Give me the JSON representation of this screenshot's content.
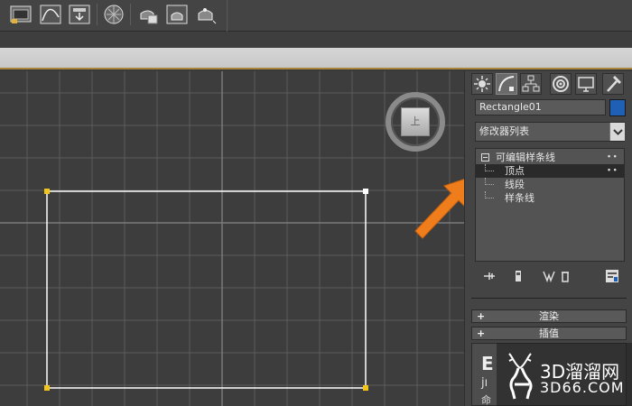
{
  "toolbar": {
    "icons": [
      "layer-manager-icon",
      "curve-editor-icon",
      "schematic-view-icon",
      "material-editor-icon",
      "render-setup-icon",
      "rendered-frame-icon",
      "render-icon"
    ]
  },
  "viewport": {
    "viewcube_label": "上"
  },
  "panel": {
    "tabs": [
      "create-tab",
      "modify-tab",
      "hierarchy-tab",
      "motion-tab",
      "display-tab",
      "utilities-tab"
    ],
    "active_tab": "modify-tab",
    "object_name": "Rectangle01",
    "object_color": "#1f5fb4",
    "modifier_list": "修改器列表",
    "stack": {
      "root": "可编辑样条线",
      "items": [
        {
          "label": "顶点",
          "selected": true
        },
        {
          "label": "线段",
          "selected": false
        },
        {
          "label": "样条线",
          "selected": false
        }
      ]
    },
    "rollouts": [
      {
        "sign": "+",
        "label": "渲染"
      },
      {
        "sign": "+",
        "label": "插值"
      }
    ],
    "partial_text": {
      "big": "E",
      "small": "jı",
      "bottom": "命"
    }
  },
  "watermark": {
    "brand": "3D溜溜网",
    "url": "3D66.COM"
  },
  "colors": {
    "selection_vertex": "#f0c419",
    "spline": "#ffffff",
    "arrow": "#f07d1c"
  }
}
